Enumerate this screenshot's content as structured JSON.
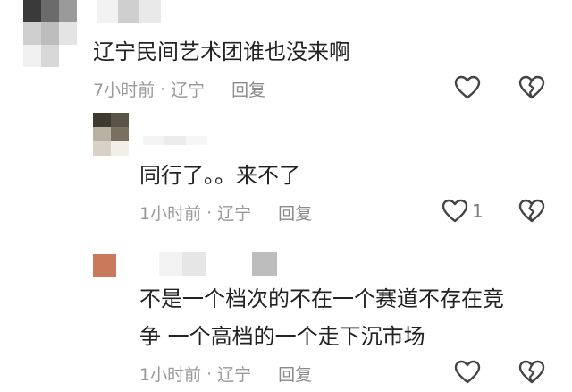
{
  "comments": [
    {
      "text": "辽宁民间艺术团谁也没来啊",
      "time": "7小时前",
      "separator": "·",
      "location": "辽宁",
      "reply_label": "回复",
      "like_count": "",
      "avatar_colors": [
        "#3a3a3a",
        "#6b6b6b",
        "#9a9a9a",
        "#cfcfcf",
        "#bdbdbd",
        "#e4e4e4",
        "#f0f0f0",
        "#d8d8d8",
        "#ffffff"
      ]
    },
    {
      "text": "同行了。。来不了",
      "time": "1小时前",
      "separator": "·",
      "location": "辽宁",
      "reply_label": "回复",
      "like_count": "1",
      "avatar_colors": [
        "#3d3a30",
        "#5a5448",
        "#b8b0a0",
        "#7a7060",
        "#d8d2c6",
        "#f2efe8"
      ]
    },
    {
      "text_lines": [
        "不是一个档次的不在一个赛道不存在竞",
        "争 一个高档的一个走下沉市场"
      ],
      "time": "1小时前",
      "separator": "·",
      "location": "辽宁",
      "reply_label": "回复",
      "like_count": "",
      "avatar_colors": [
        "#c97a5c"
      ]
    }
  ],
  "icons": {
    "like": "heart-outline-icon",
    "dislike": "broken-heart-icon"
  },
  "colors": {
    "text": "#222222",
    "meta": "#9a9a9a",
    "icon": "#444444"
  }
}
